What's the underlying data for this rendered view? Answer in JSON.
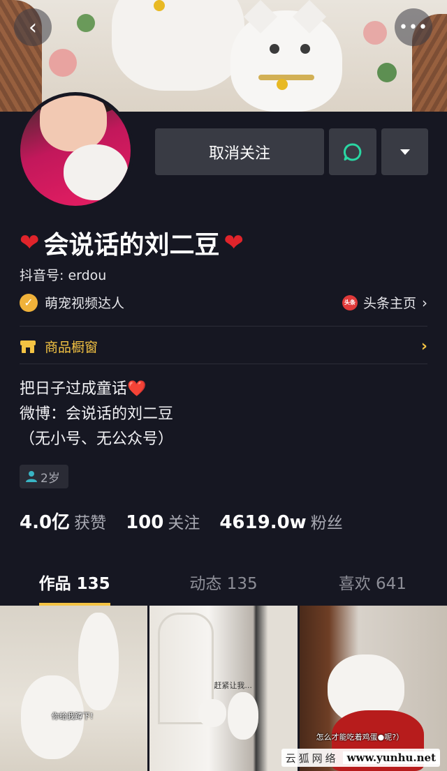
{
  "header": {
    "back_icon": "chevron-left-icon",
    "more_icon": "more-dots-icon",
    "more_glyph": "•••"
  },
  "actions": {
    "unfollow_label": "取消关注",
    "message_icon": "chat-bubble-icon",
    "dropdown_icon": "caret-down-icon"
  },
  "profile": {
    "name": "会说话的刘二豆",
    "name_heart_icon": "red-heart-icon",
    "douyin_id": "抖音号: erdou",
    "verified_label": "萌宠视频达人",
    "toutiao_label": "头条主页",
    "toutiao_icon_text": "头条",
    "shop_label": "商品橱窗",
    "bio": "把日子过成童话❤️\n微博：会说话的刘二豆\n（无小号、无公众号）",
    "age_tag": "2岁"
  },
  "stats": [
    {
      "num": "4.0亿",
      "label": "获赞"
    },
    {
      "num": "100",
      "label": "关注"
    },
    {
      "num": "4619.0w",
      "label": "粉丝"
    }
  ],
  "tabs": [
    {
      "label": "作品 135",
      "active": true
    },
    {
      "label": "动态 135",
      "active": false
    },
    {
      "label": "喜欢 641",
      "active": false
    }
  ],
  "videos": [
    {
      "caption": "你给我蹲下!"
    },
    {
      "caption": "赶紧让我..."
    },
    {
      "caption": "怎么才能吃着鸡蛋●呢?）"
    }
  ],
  "watermark": {
    "cn": "云狐网络",
    "url": "www.yunhu.net"
  },
  "colors": {
    "background": "#161722",
    "accent_yellow": "#f4c343",
    "button_bg": "#393b44",
    "message_green": "#2ad7a3"
  }
}
